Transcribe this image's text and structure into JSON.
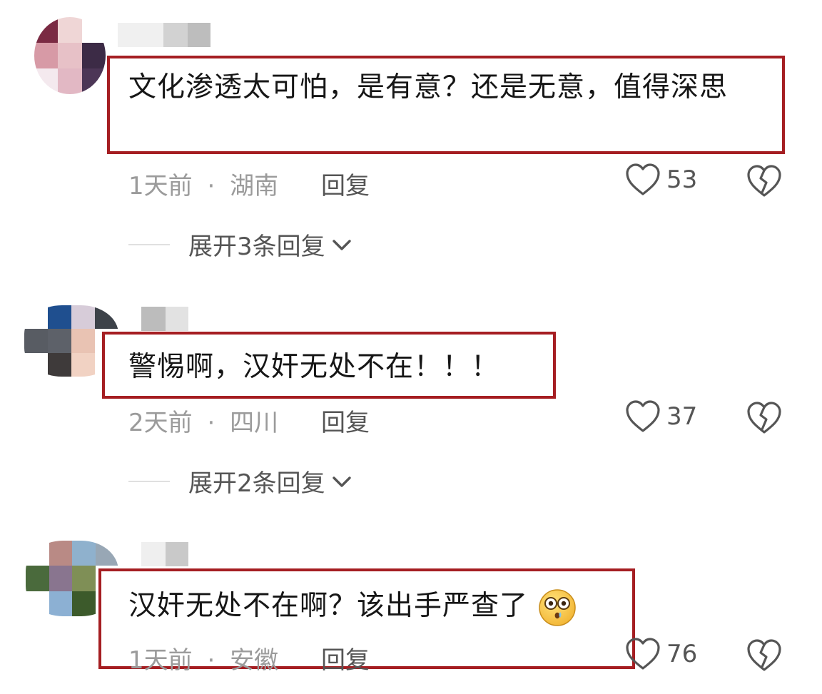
{
  "comments": [
    {
      "text": "文化渗透太可怕，是有意？还是无意，值得深思",
      "time": "1天前",
      "sep": "·",
      "location": "湖南",
      "reply_label": "回复",
      "likes": "53",
      "expand_label": "展开3条回复"
    },
    {
      "text": "警惕啊，汉奸无处不在！！！",
      "time": "2天前",
      "sep": "·",
      "location": "四川",
      "reply_label": "回复",
      "likes": "37",
      "expand_label": "展开2条回复"
    },
    {
      "text": "汉奸无处不在啊？该出手严查了",
      "time": "1天前",
      "sep": "·",
      "location": "安徽",
      "reply_label": "回复",
      "likes": "76"
    }
  ],
  "icons": {
    "like": "heart-outline-icon",
    "dislike": "broken-heart-icon",
    "expand": "chevron-down-icon",
    "emoji": "shocked-face-emoji"
  },
  "colors": {
    "highlight_box": "#a51e22",
    "text": "#161616",
    "meta": "#9b9b9b"
  }
}
